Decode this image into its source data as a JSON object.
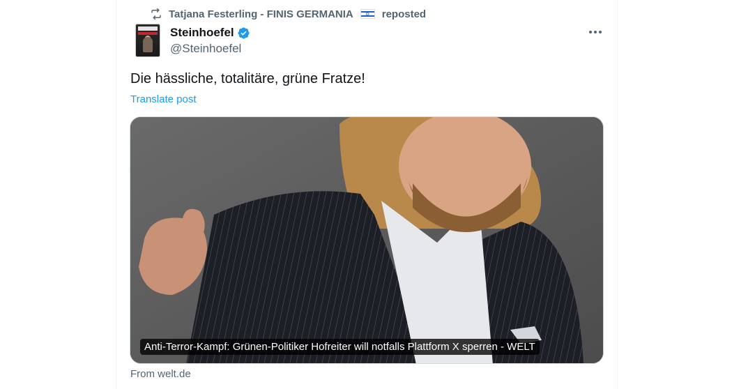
{
  "repost": {
    "icon": "repost-icon",
    "user": "Tatjana Festerling - FINIS GERMANIA",
    "flag": "israel-flag",
    "suffix": "reposted"
  },
  "author": {
    "display_name": "Steinhoefel",
    "verified": true,
    "verified_color": "#1d9bf0",
    "handle": "@Steinhoefel"
  },
  "post": {
    "text": "Die hässliche, totalitäre, grüne Fratze!",
    "translate_label": "Translate post"
  },
  "link_card": {
    "caption": "Anti-Terror-Kampf: Grünen-Politiker Hofreiter will notfalls Plattform X sperren - WELT",
    "source": "From welt.de"
  },
  "colors": {
    "text": "#0f1419",
    "muted": "#536471",
    "link": "#1d9bf0"
  }
}
